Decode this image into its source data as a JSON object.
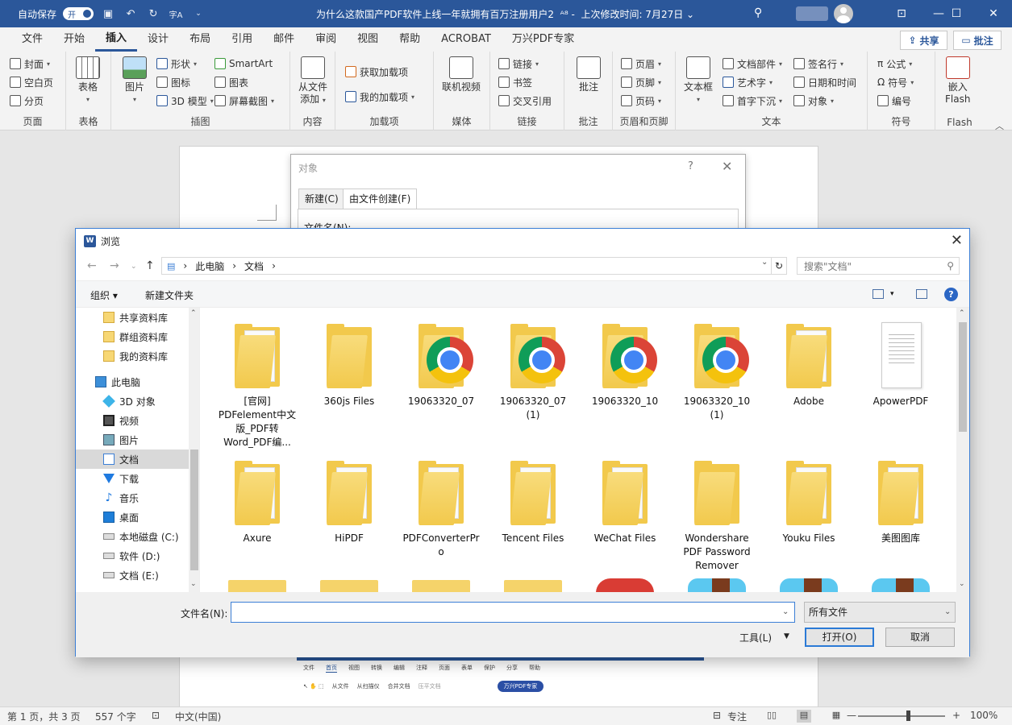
{
  "titlebar": {
    "autosave_label": "自动保存",
    "autosave_state": "开",
    "doc_title": "为什么这款国产PDF软件上线一年就拥有百万注册用户2",
    "modified": "上次修改时间: 7月27日",
    "mod_caret": "⌄",
    "accent": "#2b579a"
  },
  "tabs": [
    "文件",
    "开始",
    "插入",
    "设计",
    "布局",
    "引用",
    "邮件",
    "审阅",
    "视图",
    "帮助",
    "ACROBAT",
    "万兴PDF专家"
  ],
  "share_label": "共享",
  "comment_label": "批注",
  "ribbon": {
    "pages": {
      "label": "页面",
      "items": [
        "封面",
        "空白页",
        "分页"
      ]
    },
    "tables": {
      "label": "表格",
      "item": "表格"
    },
    "illustrations": {
      "label": "插图",
      "picture": "图片",
      "items_col1": [
        "形状",
        "图标",
        "3D 模型"
      ],
      "items_col2": [
        "SmartArt",
        "图表",
        "屏幕截图"
      ]
    },
    "content": {
      "label": "内容",
      "item_line1": "从文件",
      "item_line2": "添加"
    },
    "addins": {
      "label": "加载项",
      "items": [
        "获取加载项",
        "我的加载项"
      ]
    },
    "media": {
      "label": "媒体",
      "item": "联机视频"
    },
    "links": {
      "label": "链接",
      "items": [
        "链接",
        "书签",
        "交叉引用"
      ]
    },
    "comments": {
      "label": "批注",
      "item": "批注"
    },
    "header_footer": {
      "label": "页眉和页脚",
      "items": [
        "页眉",
        "页脚",
        "页码"
      ]
    },
    "text": {
      "label": "文本",
      "textbox_line1": "文本框",
      "items_col1": [
        "文档部件",
        "艺术字",
        "首字下沉"
      ],
      "items_col2": [
        "签名行",
        "日期和时间",
        "对象"
      ]
    },
    "symbols": {
      "label": "符号",
      "items": [
        "公式",
        "符号",
        "编号"
      ]
    },
    "flash": {
      "label": "Flash",
      "item_line1": "嵌入",
      "item_line2": "Flash"
    }
  },
  "object_dialog": {
    "title": "对象",
    "help": "?",
    "tabs": [
      "新建(C)",
      "由文件创建(F)"
    ],
    "filename_label": "文件名(N):"
  },
  "browse": {
    "title": "浏览",
    "breadcrumb": [
      "此电脑",
      "文档"
    ],
    "search_placeholder": "搜索\"文档\"",
    "organize": "组织 ▾",
    "new_folder": "新建文件夹",
    "sidebar": [
      {
        "label": "共享资料库",
        "icon": "folder-icon"
      },
      {
        "label": "群组资料库",
        "icon": "folder-icon"
      },
      {
        "label": "我的资料库",
        "icon": "folder-icon"
      },
      {
        "label": "此电脑",
        "icon": "computer-icon"
      },
      {
        "label": "3D 对象",
        "icon": "cube-icon"
      },
      {
        "label": "视频",
        "icon": "video-icon"
      },
      {
        "label": "图片",
        "icon": "picture-icon"
      },
      {
        "label": "文档",
        "icon": "document-icon"
      },
      {
        "label": "下载",
        "icon": "download-icon"
      },
      {
        "label": "音乐",
        "icon": "music-icon"
      },
      {
        "label": "桌面",
        "icon": "desktop-icon"
      },
      {
        "label": "本地磁盘 (C:)",
        "icon": "drive-icon"
      },
      {
        "label": "软件 (D:)",
        "icon": "drive-icon"
      },
      {
        "label": "文档 (E:)",
        "icon": "drive-icon"
      }
    ],
    "files_row1": [
      {
        "name": "[官网]\nPDFelement中文\n版_PDF转\nWord_PDF编...",
        "kind": "folder-paper"
      },
      {
        "name": "360js Files",
        "kind": "folder-empty"
      },
      {
        "name": "19063320_07",
        "kind": "chrome"
      },
      {
        "name": "19063320_07\n(1)",
        "kind": "chrome"
      },
      {
        "name": "19063320_10",
        "kind": "chrome"
      },
      {
        "name": "19063320_10\n(1)",
        "kind": "chrome"
      },
      {
        "name": "Adobe",
        "kind": "folder-paper"
      },
      {
        "name": "ApowerPDF",
        "kind": "pdf"
      }
    ],
    "files_row2": [
      {
        "name": "Axure",
        "kind": "folder-lines"
      },
      {
        "name": "HiPDF",
        "kind": "folder-lines"
      },
      {
        "name": "PDFConverterPr\no",
        "kind": "folder-lines"
      },
      {
        "name": "Tencent Files",
        "kind": "folder-lines"
      },
      {
        "name": "WeChat Files",
        "kind": "folder-lines"
      },
      {
        "name": "Wondershare\nPDF Password\nRemover",
        "kind": "folder-empty"
      },
      {
        "name": "Youku Files",
        "kind": "folder-lines"
      },
      {
        "name": "美图图库",
        "kind": "folder-lines"
      }
    ],
    "filename_label": "文件名(N):",
    "filename_value": "",
    "filetype": "所有文件",
    "tools": "工具(L)",
    "open": "打开(O)",
    "cancel": "取消"
  },
  "embedded": {
    "menu": [
      "文件",
      "首页",
      "视图",
      "转换",
      "编辑",
      "注释",
      "页面",
      "表单",
      "保护",
      "分享",
      "帮助"
    ],
    "tools": [
      "从文件",
      "从扫描仪",
      "合并文档",
      "压平文档"
    ],
    "button": "万兴PDF专家"
  },
  "statusbar": {
    "page": "第 1 页，共 3 页",
    "words": "557 个字",
    "lang": "中文(中国)",
    "focus": "专注",
    "zoom_minus": "—",
    "zoom_plus": "+",
    "zoom": "100%"
  }
}
